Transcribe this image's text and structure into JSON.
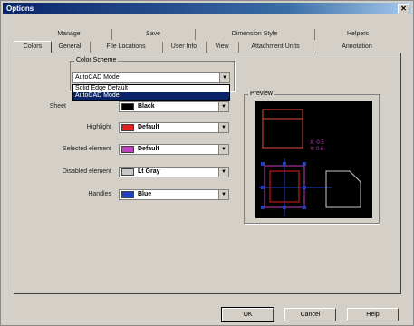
{
  "window": {
    "title": "Options"
  },
  "tabs_back": [
    {
      "label": "Manage"
    },
    {
      "label": "Save"
    },
    {
      "label": "Dimension Style"
    },
    {
      "label": "Helpers"
    }
  ],
  "tabs_front": [
    {
      "label": "Colors"
    },
    {
      "label": "General"
    },
    {
      "label": "File Locations"
    },
    {
      "label": "User Info"
    },
    {
      "label": "View"
    },
    {
      "label": "Attachment Units"
    },
    {
      "label": "Annotation"
    }
  ],
  "color_scheme": {
    "group_label": "Color Scheme",
    "selected": "AutoCAD Model",
    "options": [
      "Solid Edge Default",
      "AutoCAD Model"
    ]
  },
  "elements": [
    {
      "label": "Sheet",
      "value": "Black",
      "color": "#000000"
    },
    {
      "label": "Highlight",
      "value": "Default",
      "color": "#e02020"
    },
    {
      "label": "Selected element",
      "value": "Default",
      "color": "#c040c0"
    },
    {
      "label": "Disabled element",
      "value": "Lt Gray",
      "color": "#c8c8c8"
    },
    {
      "label": "Handles",
      "value": "Blue",
      "color": "#2040c0"
    }
  ],
  "preview": {
    "label": "Preview",
    "readout": [
      "X: 0.5",
      "Y: 0.6"
    ]
  },
  "buttons": {
    "ok": "OK",
    "cancel": "Cancel",
    "help": "Help"
  }
}
